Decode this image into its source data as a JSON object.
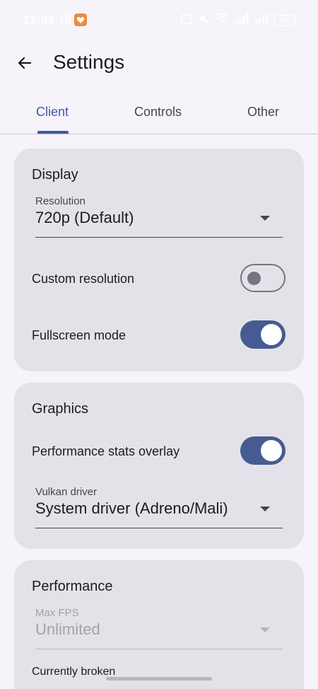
{
  "status_bar": {
    "time": "12:01",
    "battery": "88"
  },
  "app_bar": {
    "title": "Settings"
  },
  "tabs": [
    {
      "label": "Client",
      "active": true
    },
    {
      "label": "Controls",
      "active": false
    },
    {
      "label": "Other",
      "active": false
    }
  ],
  "display": {
    "title": "Display",
    "resolution_label": "Resolution",
    "resolution_value": "720p (Default)",
    "custom_resolution_label": "Custom resolution",
    "custom_resolution_on": false,
    "fullscreen_label": "Fullscreen mode",
    "fullscreen_on": true
  },
  "graphics": {
    "title": "Graphics",
    "perf_overlay_label": "Performance stats overlay",
    "perf_overlay_on": true,
    "vulkan_label": "Vulkan driver",
    "vulkan_value": "System driver (Adreno/Mali)"
  },
  "performance": {
    "title": "Performance",
    "max_fps_label": "Max FPS",
    "max_fps_value": "Unlimited",
    "note": "Currently broken"
  },
  "colors": {
    "accent": "#3d5a9e",
    "switch_on": "#455b91",
    "card_bg": "#e4e2e9",
    "page_bg": "#f6f4fa"
  }
}
